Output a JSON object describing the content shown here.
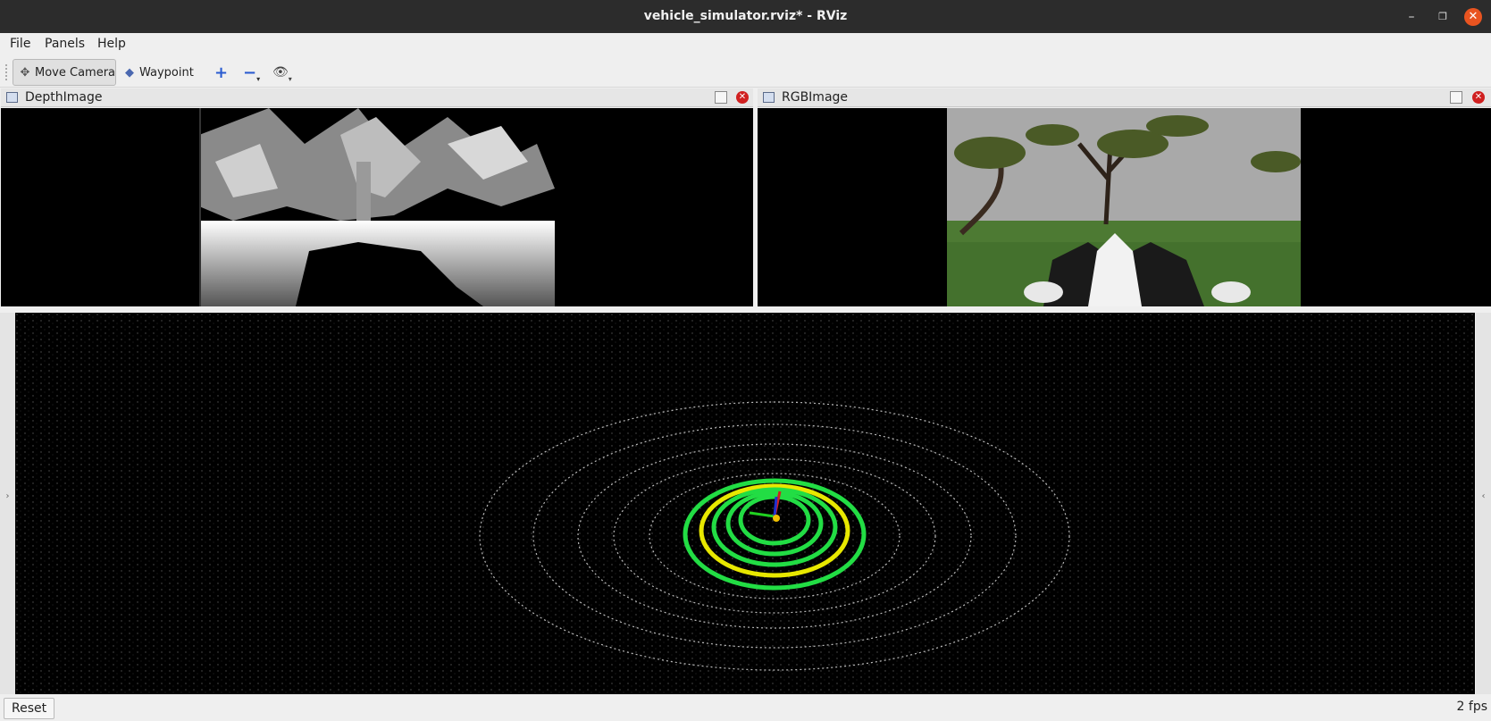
{
  "window": {
    "title": "vehicle_simulator.rviz* - RViz"
  },
  "menu": {
    "file": "File",
    "panels": "Panels",
    "help": "Help"
  },
  "toolbar": {
    "move_camera": "Move Camera",
    "waypoint": "Waypoint"
  },
  "panels": {
    "depth_title": "DepthImage",
    "rgb_title": "RGBImage"
  },
  "status": {
    "reset": "Reset",
    "fps": "2 fps"
  },
  "colors": {
    "titlebar": "#2c2c2c",
    "close": "#e95420",
    "scan_green": "#22dd44",
    "scan_yellow": "#e8e800"
  }
}
